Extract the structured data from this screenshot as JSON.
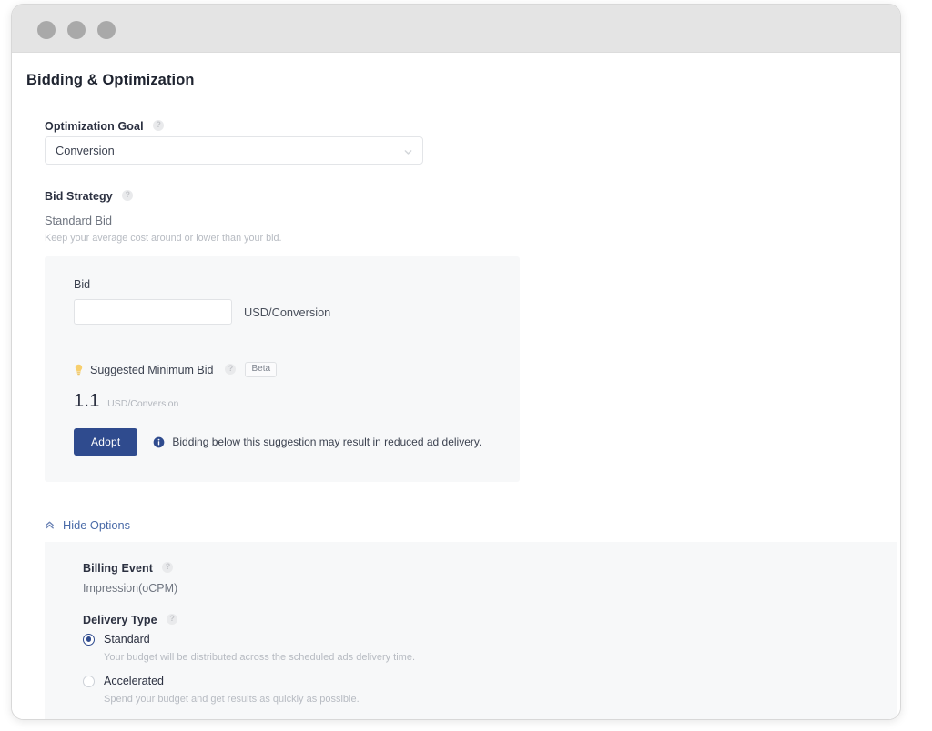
{
  "window": {
    "traffic_lights": [
      "close",
      "minimize",
      "maximize"
    ]
  },
  "page": {
    "title": "Bidding & Optimization"
  },
  "optimization_goal": {
    "label": "Optimization Goal",
    "help_icon": "help-circle-icon",
    "selected": "Conversion",
    "options": [
      "Conversion"
    ],
    "chevron_icon": "chevron-down-icon"
  },
  "bid_strategy": {
    "label": "Bid Strategy",
    "help_icon": "help-circle-icon",
    "name": "Standard Bid",
    "description": "Keep your average cost around or lower than your bid."
  },
  "bid_card": {
    "bid_label": "Bid",
    "bid_value": "",
    "bid_placeholder": "",
    "bid_unit": "USD/Conversion",
    "suggested": {
      "bulb_icon": "lightbulb-icon",
      "label": "Suggested Minimum Bid",
      "help_icon": "help-circle-icon",
      "badge": "Beta",
      "value": "1.1",
      "unit": "USD/Conversion"
    },
    "adopt_label": "Adopt",
    "info_icon": "info-circle-icon",
    "note": "Bidding below this suggestion may result in reduced ad delivery."
  },
  "hide_options": {
    "icon": "double-chevron-up-icon",
    "label": "Hide Options"
  },
  "options_panel": {
    "billing_event": {
      "label": "Billing Event",
      "help_icon": "help-circle-icon",
      "value": "Impression(oCPM)"
    },
    "delivery_type": {
      "label": "Delivery Type",
      "help_icon": "help-circle-icon",
      "selected": "Standard",
      "options": [
        {
          "label": "Standard",
          "description": "Your budget will be distributed across the scheduled ads delivery time.",
          "checked": true
        },
        {
          "label": "Accelerated",
          "description": "Spend your budget and get results as quickly as possible.",
          "checked": false
        }
      ]
    }
  },
  "colors": {
    "accent_navy": "#2f4b8e",
    "link_blue": "#4a6ba8",
    "card_bg": "#f7f8f9",
    "bulb_yellow": "#f5c451",
    "titlebar_bg": "#e4e4e4",
    "dot_gray": "#a9a9a9"
  }
}
